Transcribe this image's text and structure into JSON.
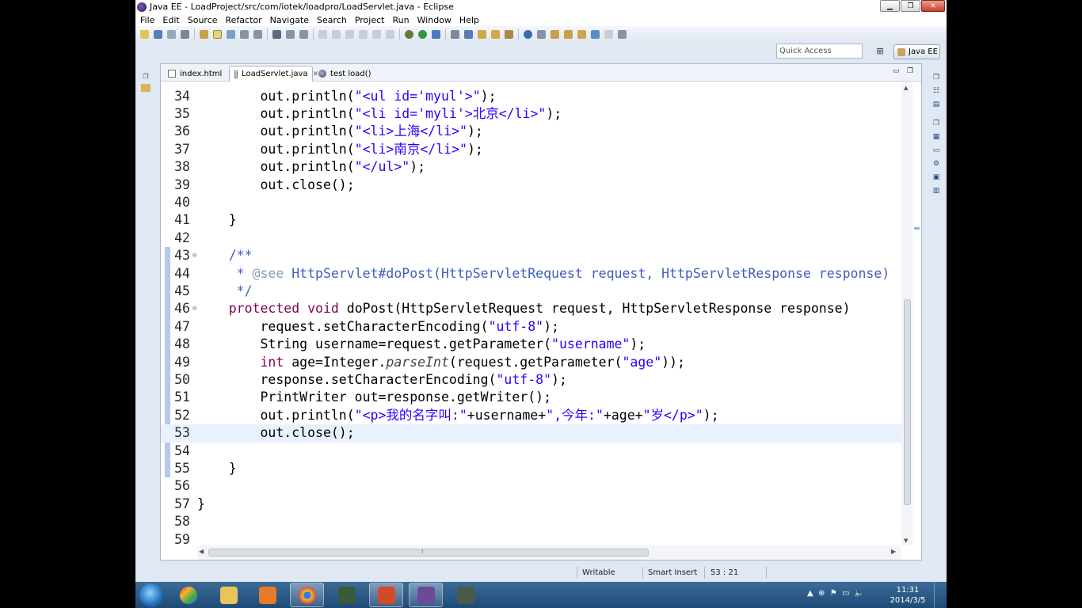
{
  "window": {
    "title": "Java EE - LoadProject/src/com/iotek/loadpro/LoadServlet.java - Eclipse"
  },
  "menu": [
    "File",
    "Edit",
    "Source",
    "Refactor",
    "Navigate",
    "Search",
    "Project",
    "Run",
    "Window",
    "Help"
  ],
  "quick_access": {
    "placeholder": "Quick Access"
  },
  "perspective": {
    "label": "Java EE"
  },
  "tabs": [
    {
      "label": "index.html",
      "icon": "html-file-icon"
    },
    {
      "label": "LoadServlet.java",
      "icon": "java-file-icon"
    },
    {
      "label": "test load()",
      "icon": "globe-icon"
    }
  ],
  "code_lines": [
    {
      "n": "34",
      "tokens": [
        [
          "",
          "        out.println("
        ],
        [
          "s",
          "\"<ul id='myul'>\""
        ],
        [
          "",
          ");"
        ]
      ]
    },
    {
      "n": "35",
      "tokens": [
        [
          "",
          "        out.println("
        ],
        [
          "s",
          "\"<li id='myli'>北京</li>\""
        ],
        [
          "",
          ");"
        ]
      ]
    },
    {
      "n": "36",
      "tokens": [
        [
          "",
          "        out.println("
        ],
        [
          "s",
          "\"<li>上海</li>\""
        ],
        [
          "",
          ");"
        ]
      ]
    },
    {
      "n": "37",
      "tokens": [
        [
          "",
          "        out.println("
        ],
        [
          "s",
          "\"<li>南京</li>\""
        ],
        [
          "",
          ");"
        ]
      ]
    },
    {
      "n": "38",
      "tokens": [
        [
          "",
          "        out.println("
        ],
        [
          "s",
          "\"</ul>\""
        ],
        [
          "",
          ");"
        ]
      ]
    },
    {
      "n": "39",
      "tokens": [
        [
          "",
          "        out.close();"
        ]
      ]
    },
    {
      "n": "40",
      "tokens": []
    },
    {
      "n": "41",
      "tokens": [
        [
          "",
          "    }"
        ]
      ]
    },
    {
      "n": "42",
      "tokens": []
    },
    {
      "n": "43",
      "marker": "⊖",
      "tokens": [
        [
          "c",
          "    /**"
        ]
      ]
    },
    {
      "n": "44",
      "tokens": [
        [
          "c",
          "     * "
        ],
        [
          "tag",
          "@see"
        ],
        [
          "c",
          " HttpServlet#doPost(HttpServletRequest request, HttpServletResponse response)"
        ]
      ]
    },
    {
      "n": "45",
      "tokens": [
        [
          "c",
          "     */"
        ]
      ]
    },
    {
      "n": "46",
      "marker": "⊖",
      "tokens": [
        [
          "k",
          "    protected"
        ],
        [
          "",
          " "
        ],
        [
          "k",
          "void"
        ],
        [
          "",
          " doPost(HttpServletRequest request, HttpServletResponse response)"
        ]
      ]
    },
    {
      "n": "47",
      "tokens": [
        [
          "",
          "        request.setCharacterEncoding("
        ],
        [
          "s",
          "\"utf-8\""
        ],
        [
          "",
          ");"
        ]
      ]
    },
    {
      "n": "48",
      "tokens": [
        [
          "",
          "        String username=request.getParameter("
        ],
        [
          "s",
          "\"username\""
        ],
        [
          "",
          ");"
        ]
      ]
    },
    {
      "n": "49",
      "tokens": [
        [
          "k",
          "        int"
        ],
        [
          "",
          " age=Integer."
        ],
        [
          "it",
          "parseInt"
        ],
        [
          "",
          "(request.getParameter("
        ],
        [
          "s",
          "\"age\""
        ],
        [
          "",
          "));"
        ]
      ]
    },
    {
      "n": "50",
      "tokens": [
        [
          "",
          "        response.setCharacterEncoding("
        ],
        [
          "s",
          "\"utf-8\""
        ],
        [
          "",
          ");"
        ]
      ]
    },
    {
      "n": "51",
      "tokens": [
        [
          "",
          "        PrintWriter out=response.getWriter();"
        ]
      ]
    },
    {
      "n": "52",
      "tokens": [
        [
          "",
          "        out.println("
        ],
        [
          "s",
          "\"<p>我的名字叫:\""
        ],
        [
          "",
          "+username+"
        ],
        [
          "s",
          "\",今年:\""
        ],
        [
          "",
          "+age+"
        ],
        [
          "s",
          "\"岁</p>\""
        ],
        [
          "",
          ");"
        ]
      ]
    },
    {
      "n": "53",
      "current": true,
      "tokens": [
        [
          "",
          "        out.close();"
        ]
      ]
    },
    {
      "n": "54",
      "tokens": []
    },
    {
      "n": "55",
      "tokens": [
        [
          "",
          "    }"
        ]
      ]
    },
    {
      "n": "56",
      "tokens": []
    },
    {
      "n": "57",
      "tokens": [
        [
          "",
          "}"
        ]
      ]
    },
    {
      "n": "58",
      "tokens": []
    },
    {
      "n": "59",
      "tokens": []
    }
  ],
  "status": {
    "writable": "Writable",
    "insert_mode": "Smart Insert",
    "position": "53 : 21"
  },
  "clock": {
    "time": "11:31",
    "date": "2014/3/5"
  },
  "colors": {
    "keyword": "#7f0055",
    "string": "#2a00ff",
    "javadoc": "#3f5fbf",
    "current_line": "#e8f2fe"
  }
}
